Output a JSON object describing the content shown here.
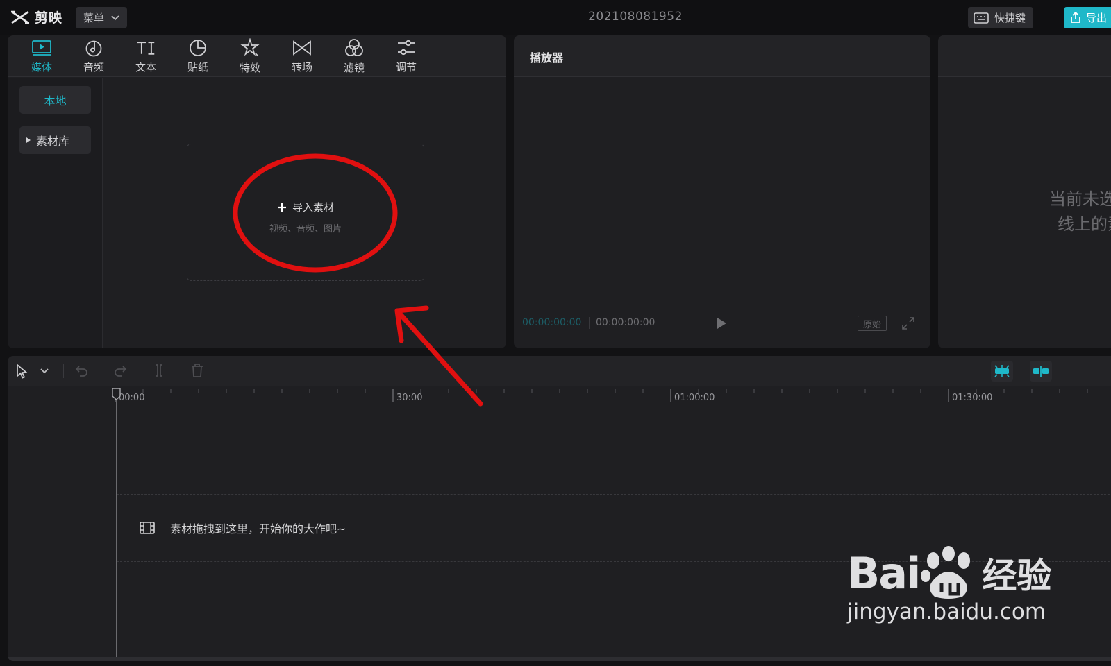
{
  "app": {
    "logo_text": "剪映",
    "menu_label": "菜单",
    "project_title": "202108081952",
    "shortcut_label": "快捷键",
    "export_label": "导出"
  },
  "media_panel": {
    "tabs": [
      {
        "label": "媒体",
        "icon": "media-icon",
        "active": true
      },
      {
        "label": "音频",
        "icon": "audio-icon",
        "active": false
      },
      {
        "label": "文本",
        "icon": "text-icon",
        "active": false
      },
      {
        "label": "贴纸",
        "icon": "sticker-icon",
        "active": false
      },
      {
        "label": "特效",
        "icon": "effects-icon",
        "active": false
      },
      {
        "label": "转场",
        "icon": "transition-icon",
        "active": false
      },
      {
        "label": "滤镜",
        "icon": "filter-icon",
        "active": false
      },
      {
        "label": "调节",
        "icon": "adjust-icon",
        "active": false
      }
    ],
    "sidebar": {
      "local_label": "本地",
      "library_label": "素材库"
    },
    "import": {
      "label": "导入素材",
      "hint": "视频、音频、图片"
    }
  },
  "player": {
    "title": "播放器",
    "current_time": "00:00:00:00",
    "total_time": "00:00:00:00",
    "ratio_label": "原始"
  },
  "properties": {
    "empty_line1": "当前未选中",
    "empty_line2": "线上的素"
  },
  "timeline": {
    "ruler_labels": [
      "00:00",
      "30:00",
      "01:00:00",
      "01:30:00"
    ],
    "drop_hint": "素材拖拽到这里，开始你的大作吧~"
  },
  "watermark": {
    "brand": "Bai",
    "brand_suffix": "经验",
    "url": "jingyan.baidu.com"
  },
  "colors": {
    "accent": "#1fb8c9",
    "panel": "#1f1f22",
    "background": "#121214",
    "annotation_red": "#e01010"
  }
}
